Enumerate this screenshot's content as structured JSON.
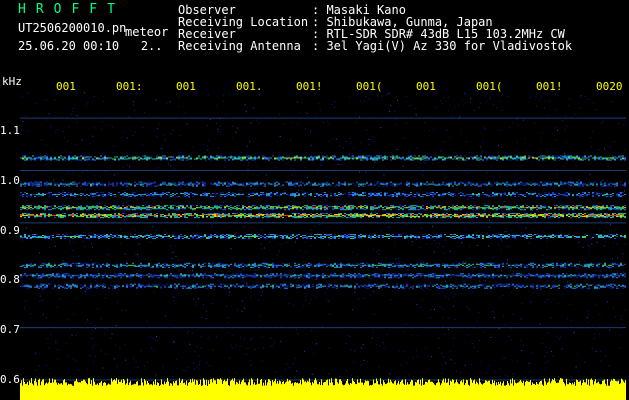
{
  "header": {
    "logo": "HROFFT",
    "filename": "UT2506200010.pn",
    "meteor": "meteor",
    "datetime": "25.06.20 00:10   2..",
    "rows": [
      {
        "label": "Observer",
        "value": ": Masaki Kano"
      },
      {
        "label": "Receiving Location",
        "value": ": Shibukawa, Gunma, Japan"
      },
      {
        "label": "Receiver",
        "value": ": RTL-SDR SDR# 43dB L15 103.2MHz CW"
      },
      {
        "label": "Receiving Antenna",
        "value": ": 3el Yagi(V) Az 330 for Vladivostok"
      }
    ]
  },
  "axis": {
    "unit": "kHz",
    "y_ticks": [
      "1.1",
      "1.0",
      "0.9",
      "0.8",
      "0.7",
      "0.6"
    ],
    "x_ticks": [
      "001",
      "001:",
      "001",
      "001.",
      "001!",
      "001(",
      "001",
      "001(",
      "001!",
      "0020"
    ]
  },
  "colors": {
    "background": "#000000",
    "grid": "#1e3c78",
    "tick_text": "#ffff00",
    "power_bar": "#ffff00",
    "logo": "#00ff7f"
  },
  "chart_data": {
    "type": "heatmap",
    "ylabel": "kHz",
    "ylim": [
      0.6,
      1.15
    ],
    "bands_khz": [
      1.025,
      0.975,
      0.955,
      0.93,
      0.915,
      0.875,
      0.82,
      0.8,
      0.78
    ],
    "band_intensity": [
      0.55,
      0.3,
      0.3,
      0.7,
      0.9,
      0.45,
      0.4,
      0.3,
      0.3
    ]
  }
}
